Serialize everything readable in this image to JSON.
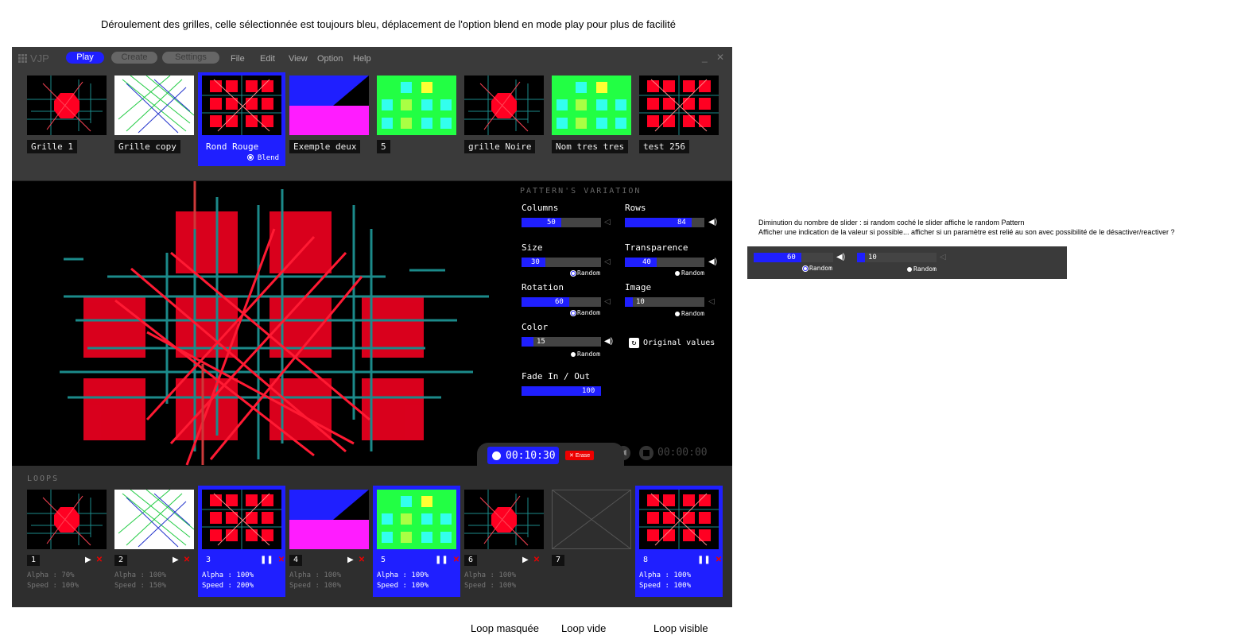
{
  "annotations": {
    "top": "Déroulement des grilles, celle sélectionnée est toujours bleu, déplacement de l'option blend en mode play pour plus de facilité",
    "side_line1": "Diminution du nombre de slider : si random coché le slider affiche le random Pattern",
    "side_line2": "Afficher une indication de la valeur si possible... afficher si un paramètre est relié au son avec possibilité de le désactiver/reactiver ?",
    "loop_hidden": "Loop masquée",
    "loop_empty": "Loop vide",
    "loop_visible": "Loop visible"
  },
  "app": {
    "logo": "VJP"
  },
  "modes": {
    "play": "Play",
    "create": "Create",
    "settings": "Settings"
  },
  "menu": {
    "file": "File",
    "edit": "Edit",
    "view": "View",
    "option": "Option",
    "help": "Help"
  },
  "window_controls": "_ ✕",
  "grids": [
    {
      "label": "Grille 1",
      "thumb": "red-octagon",
      "selected": false
    },
    {
      "label": "Grille copy",
      "thumb": "white-lines",
      "selected": false
    },
    {
      "label": "Rond Rouge",
      "thumb": "red-squares",
      "selected": true
    },
    {
      "label": "Exemple deux",
      "thumb": "blue-magenta",
      "selected": false
    },
    {
      "label": "5",
      "thumb": "green-squares",
      "selected": false
    },
    {
      "label": "grille Noire",
      "thumb": "red-octagon",
      "selected": false
    },
    {
      "label": "Nom tres tres",
      "thumb": "green-squares",
      "selected": false
    },
    {
      "label": "test 256",
      "thumb": "red-squares",
      "selected": false
    }
  ],
  "blend_label": "Blend",
  "variation": {
    "title": "PATTERN'S VARIATION",
    "random_label": "Random",
    "params": {
      "columns": {
        "label": "Columns",
        "value": 50,
        "fill": 0.5,
        "sound": false,
        "random": null
      },
      "rows": {
        "label": "Rows",
        "value": 84,
        "fill": 0.84,
        "sound": true,
        "random": null
      },
      "size": {
        "label": "Size",
        "value": 30,
        "fill": 0.3,
        "sound": false,
        "random": "checked"
      },
      "transparence": {
        "label": "Transparence",
        "value": 40,
        "fill": 0.4,
        "sound": true,
        "random": "dot"
      },
      "rotation": {
        "label": "Rotation",
        "value": 60,
        "fill": 0.6,
        "sound": false,
        "random": "checked"
      },
      "image": {
        "label": "Image",
        "value": 10,
        "fill": 0.1,
        "sound": false,
        "random": "dot"
      },
      "color": {
        "label": "Color",
        "value": 15,
        "fill": 0.15,
        "sound": true,
        "random": "dot"
      },
      "fade": {
        "label": "Fade In / Out",
        "value": 100,
        "fill": 1.0,
        "sound": false,
        "random": null
      }
    },
    "original_values": "Original values"
  },
  "recorder": {
    "time": "00:10:30",
    "erase": "Erase",
    "time2": "00:00:00"
  },
  "loops_title": "LOOPS",
  "loops": [
    {
      "num": "1",
      "thumb": "red-octagon",
      "state": "play",
      "alpha": "Alpha : 70%",
      "speed": "Speed : 100%",
      "active": false
    },
    {
      "num": "2",
      "thumb": "white-lines",
      "state": "play",
      "alpha": "Alpha : 100%",
      "speed": "Speed : 150%",
      "active": false
    },
    {
      "num": "3",
      "thumb": "red-squares",
      "state": "pause",
      "alpha": "Alpha : 100%",
      "speed": "Speed : 200%",
      "active": true
    },
    {
      "num": "4",
      "thumb": "blue-magenta",
      "state": "play",
      "alpha": "Alpha : 100%",
      "speed": "Speed : 100%",
      "active": false
    },
    {
      "num": "5",
      "thumb": "green-squares",
      "state": "pause",
      "alpha": "Alpha : 100%",
      "speed": "Speed : 100%",
      "active": true
    },
    {
      "num": "6",
      "thumb": "red-octagon",
      "state": "play",
      "alpha": "Alpha : 100%",
      "speed": "Speed : 100%",
      "active": false
    },
    {
      "num": "7",
      "thumb": "empty",
      "state": "none",
      "alpha": "",
      "speed": "",
      "active": false
    },
    {
      "num": "8",
      "thumb": "red-squares",
      "state": "pause",
      "alpha": "Alpha : 100%",
      "speed": "Speed : 100%",
      "active": true
    }
  ],
  "side_demo": {
    "a": {
      "value": 60,
      "fill": 0.6,
      "random": "Random"
    },
    "b": {
      "value": 10,
      "fill": 0.1,
      "random": "Random"
    }
  },
  "colors": {
    "accent": "#1f1fff",
    "red": "#ff0022",
    "green": "#22ff44",
    "magenta": "#ff1cff",
    "teal": "#1b8a8a"
  }
}
